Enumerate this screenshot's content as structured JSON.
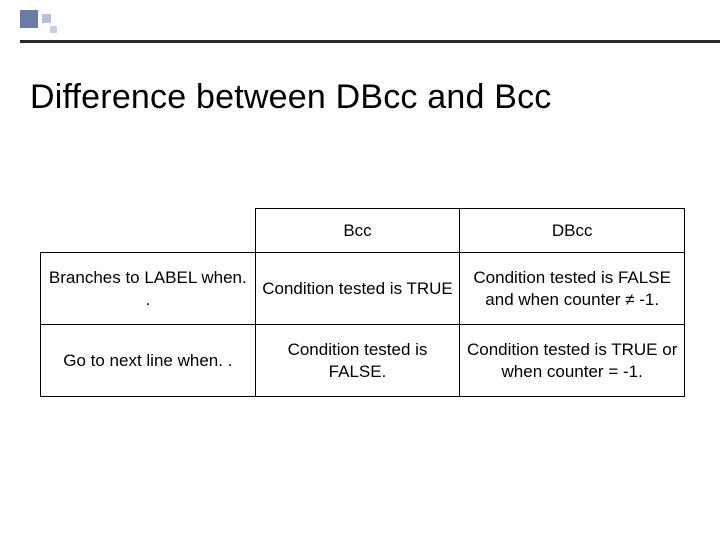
{
  "title": "Difference between DBcc and Bcc",
  "table": {
    "headers": {
      "col1": "Bcc",
      "col2": "DBcc"
    },
    "rows": [
      {
        "label": "Branches to LABEL when. .",
        "bcc": "Condition tested is TRUE",
        "dbcc": "Condition tested is FALSE and when counter ≠ -1."
      },
      {
        "label": "Go to next line when. .",
        "bcc": "Condition tested is FALSE.",
        "dbcc": "Condition tested is TRUE or when counter = -1."
      }
    ]
  }
}
